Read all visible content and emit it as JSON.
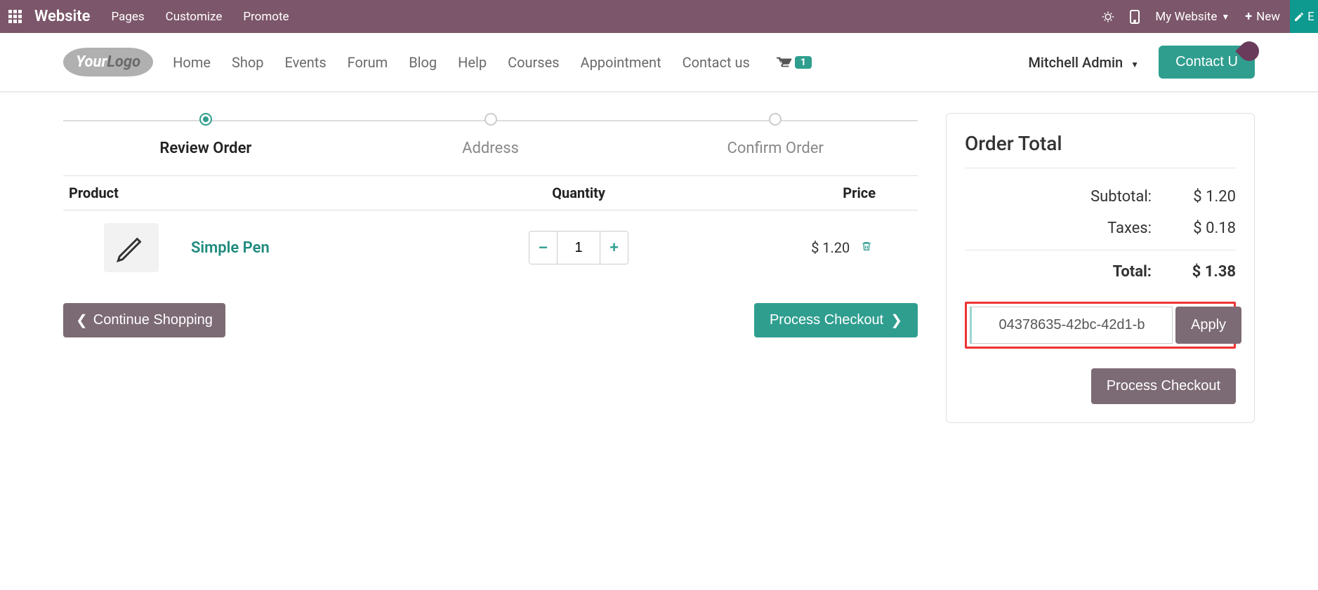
{
  "topbar": {
    "brand": "Website",
    "menu": [
      "Pages",
      "Customize",
      "Promote"
    ],
    "website_switch": "My Website",
    "new_label": "New",
    "edit_label": "E"
  },
  "site": {
    "logo_part1": "Your",
    "logo_part2": "Logo",
    "nav": [
      "Home",
      "Shop",
      "Events",
      "Forum",
      "Blog",
      "Help",
      "Courses",
      "Appointment",
      "Contact us"
    ],
    "cart_count": "1",
    "user": "Mitchell Admin",
    "contact_btn": "Contact U"
  },
  "steps": [
    {
      "label": "Review Order",
      "active": true
    },
    {
      "label": "Address",
      "active": false
    },
    {
      "label": "Confirm Order",
      "active": false
    }
  ],
  "table": {
    "headers": {
      "product": "Product",
      "quantity": "Quantity",
      "price": "Price"
    },
    "items": [
      {
        "name": "Simple Pen",
        "qty": "1",
        "price": "$ 1.20"
      }
    ]
  },
  "buttons": {
    "continue": "Continue Shopping",
    "process": "Process Checkout",
    "apply": "Apply",
    "process2": "Process Checkout"
  },
  "summary": {
    "title": "Order Total",
    "subtotal_label": "Subtotal:",
    "subtotal_value": "$ 1.20",
    "taxes_label": "Taxes:",
    "taxes_value": "$ 0.18",
    "total_label": "Total:",
    "total_value": "$ 1.38",
    "promo_value": "04378635-42bc-42d1-b"
  }
}
